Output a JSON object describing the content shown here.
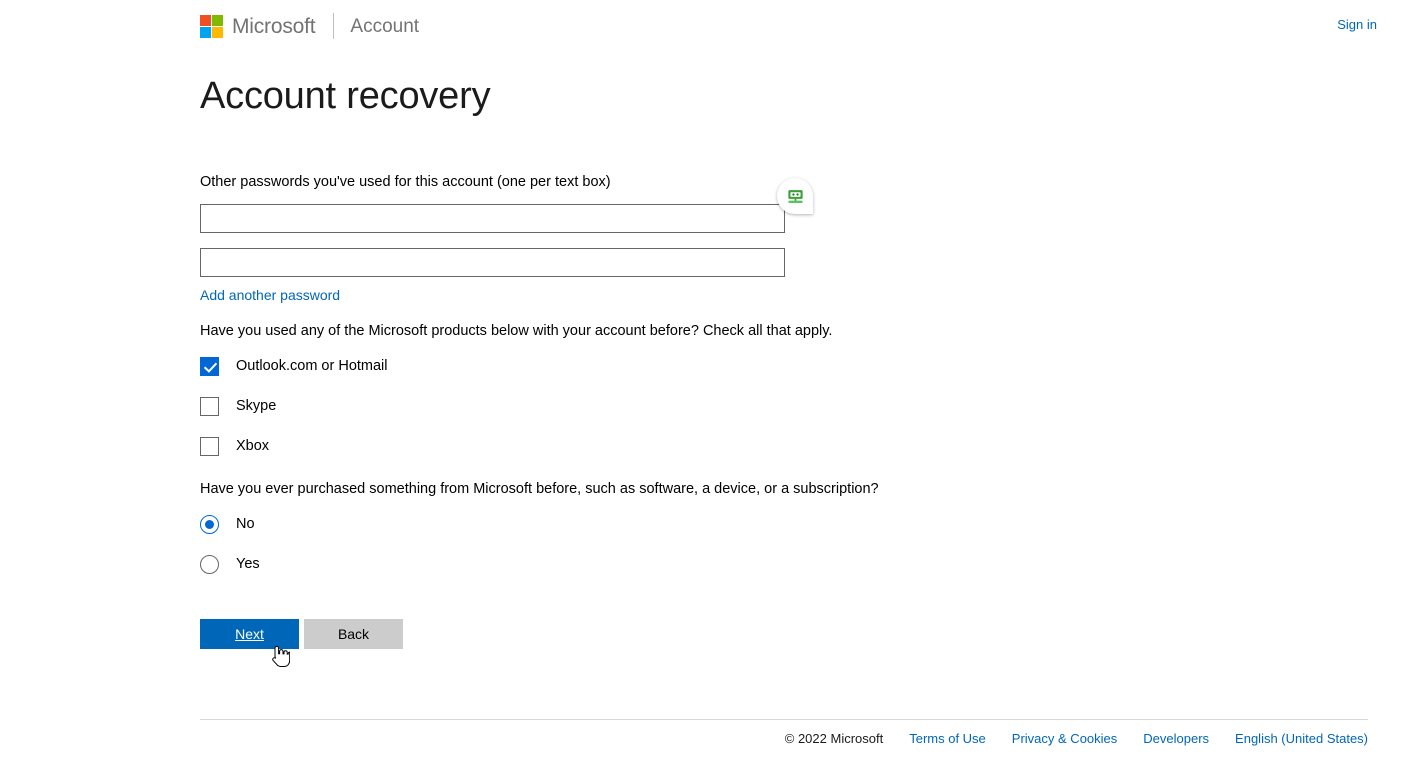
{
  "header": {
    "brand_name": "Microsoft",
    "brand_sub": "Account",
    "signin_label": "Sign in",
    "logo_colors": {
      "top_left": "#F25022",
      "top_right": "#7FBA00",
      "bottom_left": "#00A4EF",
      "bottom_right": "#FFB900"
    }
  },
  "main": {
    "page_title": "Account recovery",
    "password_prompt": "Other passwords you've used for this account (one per text box)",
    "password_fields": [
      {
        "value": "",
        "placeholder": ""
      },
      {
        "value": "",
        "placeholder": ""
      }
    ],
    "add_another_password_label": "Add another password",
    "products_question": "Have you used any of the Microsoft products below with your account before? Check all that apply.",
    "product_checkboxes": [
      {
        "label": "Outlook.com or Hotmail",
        "checked": true
      },
      {
        "label": "Skype",
        "checked": false
      },
      {
        "label": "Xbox",
        "checked": false
      }
    ],
    "purchase_question": "Have you ever purchased something from Microsoft before, such as software, a device, or a subscription?",
    "purchase_options": [
      {
        "label": "No",
        "selected": true
      },
      {
        "label": "Yes",
        "selected": false
      }
    ],
    "next_label": "Next",
    "back_label": "Back",
    "accent_color": "#0067b8",
    "autofill_icon": "robot-icon"
  },
  "footer": {
    "copyright": "© 2022 Microsoft",
    "links": [
      "Terms of Use",
      "Privacy & Cookies",
      "Developers",
      "English (United States)"
    ]
  }
}
